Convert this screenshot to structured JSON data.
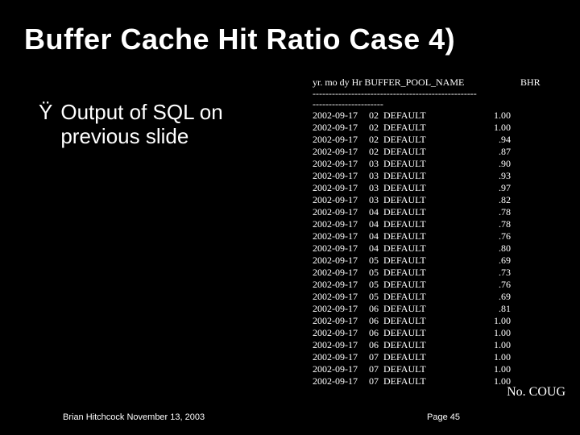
{
  "title": "Buffer Cache Hit Ratio Case 4)",
  "bullet": {
    "marker": "Ÿ",
    "line1": "Output of SQL on",
    "line2": "previous slide"
  },
  "table": {
    "header_left": "yr.  mo dy Hr BUFFER_POOL_NAME",
    "header_right": "BHR",
    "dashes1": "---------------------------------------------------",
    "dashes2": "----------------------",
    "rows": [
      {
        "date": "2002-09-17",
        "hr": "02",
        "pool": "DEFAULT",
        "bhr": "1.00"
      },
      {
        "date": "2002-09-17",
        "hr": "02",
        "pool": "DEFAULT",
        "bhr": "1.00"
      },
      {
        "date": "2002-09-17",
        "hr": "02",
        "pool": "DEFAULT",
        "bhr": ".94"
      },
      {
        "date": "2002-09-17",
        "hr": "02",
        "pool": "DEFAULT",
        "bhr": ".87"
      },
      {
        "date": "2002-09-17",
        "hr": "03",
        "pool": "DEFAULT",
        "bhr": ".90"
      },
      {
        "date": "2002-09-17",
        "hr": "03",
        "pool": "DEFAULT",
        "bhr": ".93"
      },
      {
        "date": "2002-09-17",
        "hr": "03",
        "pool": "DEFAULT",
        "bhr": ".97"
      },
      {
        "date": "2002-09-17",
        "hr": "03",
        "pool": "DEFAULT",
        "bhr": ".82"
      },
      {
        "date": "2002-09-17",
        "hr": "04",
        "pool": "DEFAULT",
        "bhr": ".78"
      },
      {
        "date": "2002-09-17",
        "hr": "04",
        "pool": "DEFAULT",
        "bhr": ".78"
      },
      {
        "date": "2002-09-17",
        "hr": "04",
        "pool": "DEFAULT",
        "bhr": ".76"
      },
      {
        "date": "2002-09-17",
        "hr": "04",
        "pool": "DEFAULT",
        "bhr": ".80"
      },
      {
        "date": "2002-09-17",
        "hr": "05",
        "pool": "DEFAULT",
        "bhr": ".69"
      },
      {
        "date": "2002-09-17",
        "hr": "05",
        "pool": "DEFAULT",
        "bhr": ".73"
      },
      {
        "date": "2002-09-17",
        "hr": "05",
        "pool": "DEFAULT",
        "bhr": ".76"
      },
      {
        "date": "2002-09-17",
        "hr": "05",
        "pool": "DEFAULT",
        "bhr": ".69"
      },
      {
        "date": "2002-09-17",
        "hr": "06",
        "pool": "DEFAULT",
        "bhr": ".81"
      },
      {
        "date": "2002-09-17",
        "hr": "06",
        "pool": "DEFAULT",
        "bhr": "1.00"
      },
      {
        "date": "2002-09-17",
        "hr": "06",
        "pool": "DEFAULT",
        "bhr": "1.00"
      },
      {
        "date": "2002-09-17",
        "hr": "06",
        "pool": "DEFAULT",
        "bhr": "1.00"
      },
      {
        "date": "2002-09-17",
        "hr": "07",
        "pool": "DEFAULT",
        "bhr": "1.00"
      },
      {
        "date": "2002-09-17",
        "hr": "07",
        "pool": "DEFAULT",
        "bhr": "1.00"
      },
      {
        "date": "2002-09-17",
        "hr": "07",
        "pool": "DEFAULT",
        "bhr": "1.00"
      }
    ]
  },
  "footer": {
    "org": "No. COUG",
    "author": "Brian Hitchcock  November 13, 2003",
    "page": "Page 45"
  }
}
